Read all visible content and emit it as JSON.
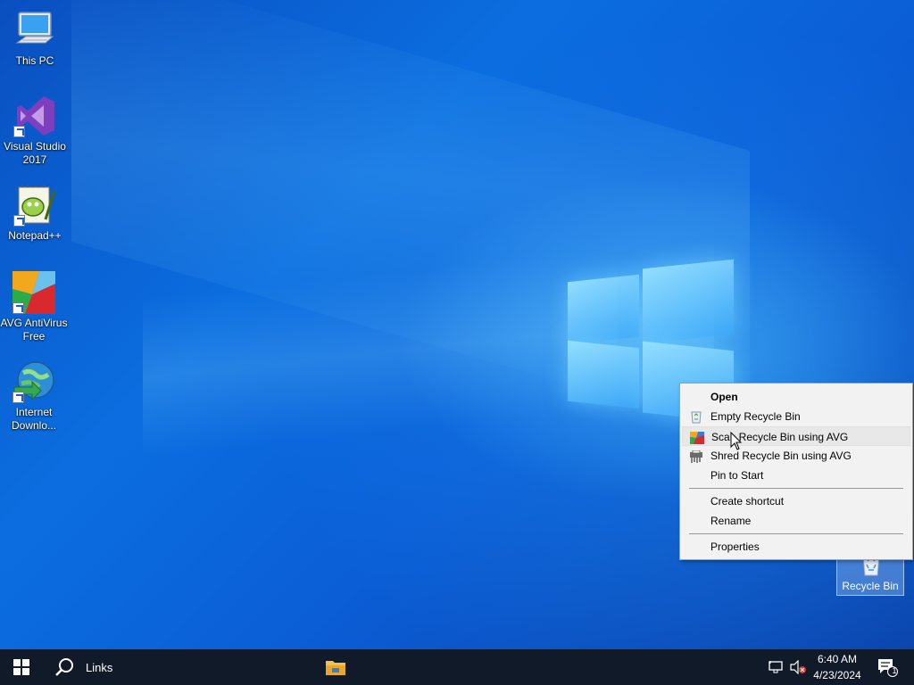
{
  "desktop": {
    "icons": [
      {
        "label": "This PC"
      },
      {
        "label": "Visual Studio 2017"
      },
      {
        "label": "Notepad++"
      },
      {
        "label": "AVG AntiVirus Free"
      },
      {
        "label": "Internet Downlo..."
      }
    ],
    "recycle_bin": {
      "label": "Recycle Bin"
    }
  },
  "context_menu": {
    "items": [
      {
        "label": "Open",
        "bold": true
      },
      {
        "label": "Empty Recycle Bin",
        "icon": "recycle-bin-empty-icon"
      },
      {
        "label": "Scan Recycle Bin using AVG",
        "icon": "avg-icon",
        "highlighted": true
      },
      {
        "label": "Shred Recycle Bin using AVG",
        "icon": "shredder-icon"
      },
      {
        "label": "Pin to Start"
      },
      {
        "label": "Create shortcut"
      },
      {
        "label": "Rename"
      },
      {
        "label": "Properties"
      }
    ]
  },
  "taskbar": {
    "search_label": "Links",
    "clock": {
      "time": "6:40 AM",
      "date": "4/23/2024"
    },
    "notification_count": "1"
  },
  "colors": {
    "taskbar": "#101a28",
    "menu_bg": "#f2f2f2",
    "menu_highlight": "#e8e8e8",
    "accent": "#0b6ee0"
  }
}
